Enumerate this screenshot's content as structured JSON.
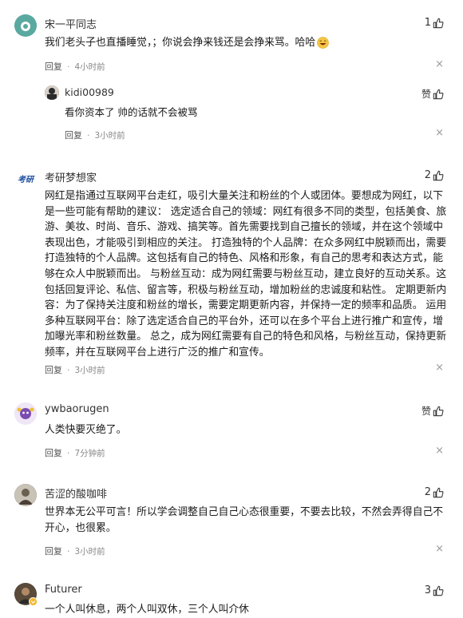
{
  "comments": [
    {
      "username": "宋一平同志",
      "text": "我们老头子也直播睡觉，；你说会挣来钱还是会挣来骂。哈哈",
      "reply_label": "回复",
      "dot": "·",
      "time": "4小时前",
      "likes": "1",
      "close": "×",
      "replies": [
        {
          "username": "kidi00989",
          "text": "看你资本了 帅的话就不会被骂",
          "reply_label": "回复",
          "dot": "·",
          "time": "3小时前",
          "likes": "赞",
          "close": "×"
        }
      ]
    },
    {
      "username": "考研梦想家",
      "avatar_text": "考研",
      "text": "网红是指通过互联网平台走红，吸引大量关注和粉丝的个人或团体。要想成为网红，以下是一些可能有帮助的建议：  选定适合自己的领域：网红有很多不同的类型，包括美食、旅游、美妆、时尚、音乐、游戏、搞笑等。首先需要找到自己擅长的领域，并在这个领域中表现出色，才能吸引到相应的关注。  打造独特的个人品牌：在众多网红中脱颖而出，需要打造独特的个人品牌。这包括有自己的特色、风格和形象，有自己的思考和表达方式，能够在众人中脱颖而出。  与粉丝互动：成为网红需要与粉丝互动，建立良好的互动关系。这包括回复评论、私信、留言等，积极与粉丝互动，增加粉丝的忠诚度和粘性。  定期更新内容：为了保持关注度和粉丝的增长，需要定期更新内容，并保持一定的频率和品质。  运用多种互联网平台：除了选定适合自己的平台外，还可以在多个平台上进行推广和宣传，增加曝光率和粉丝数量。  总之，成为网红需要有自己的特色和风格，与粉丝互动，保持更新频率，并在互联网平台上进行广泛的推广和宣传。",
      "reply_label": "回复",
      "dot": "·",
      "time": "3小时前",
      "likes": "2",
      "close": "×"
    },
    {
      "username": "ywbaorugen",
      "text": "人类快要灭绝了。",
      "reply_label": "回复",
      "dot": "·",
      "time": "7分钟前",
      "likes": "赞",
      "close": "×"
    },
    {
      "username": "苦涩的酸咖啡",
      "text": "世界本无公平可言！所以学会调整自己自己心态很重要，不要去比较，不然会弄得自己不开心，也很累。",
      "reply_label": "回复",
      "dot": "·",
      "time": "3小时前",
      "likes": "2",
      "close": "×"
    },
    {
      "username": "Futurer",
      "text": "一个人叫休息，两个人叫双休，三个人叫介休",
      "likes": "3"
    }
  ],
  "colors": {
    "avatar1": "#5aa9a0",
    "avatar_kidi": "#2b2b2b",
    "avatar_kaoyan": "#1e4fa0",
    "avatar_yw": "#7b4bb0",
    "avatar_kuse": "#6b5f4e",
    "avatar_futurer": "#3b3b3b",
    "emoji": "#f5c542"
  },
  "icons": [
    "thumb-up-icon",
    "close-icon",
    "laugh-emoji-icon",
    "vip-badge-icon"
  ]
}
